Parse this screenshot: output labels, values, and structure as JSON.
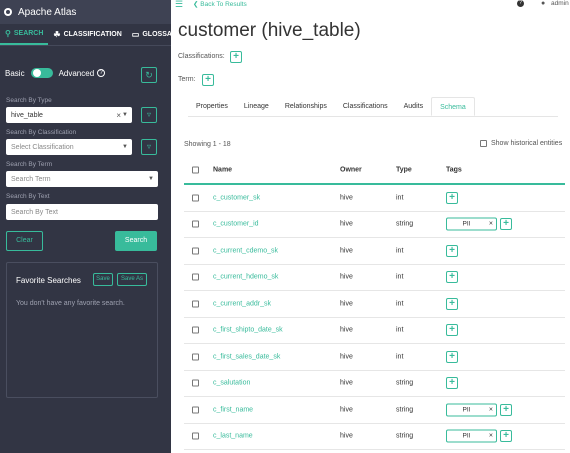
{
  "sidebar": {
    "brand": "Apache Atlas",
    "tabs": [
      {
        "label": "SEARCH",
        "icon": "search-icon"
      },
      {
        "label": "CLASSIFICATION",
        "icon": "tag-icon"
      },
      {
        "label": "GLOSSARY",
        "icon": "folder-icon"
      }
    ],
    "mode_basic": "Basic",
    "mode_advanced": "Advanced",
    "search_by_type_label": "Search By Type",
    "search_by_type_value": "hive_table",
    "search_by_classification_label": "Search By Classification",
    "search_by_classification_placeholder": "Select Classification",
    "search_by_term_label": "Search By Term",
    "search_by_term_placeholder": "Search Term",
    "search_by_text_label": "Search By Text",
    "search_by_text_placeholder": "Search By Text",
    "clear_label": "Clear",
    "search_label": "Search",
    "favorites_title": "Favorite Searches",
    "favorites_save": "Save",
    "favorites_save_as": "Save As",
    "favorites_empty": "You don't have any favorite search."
  },
  "topbar": {
    "back_label": "Back To Results",
    "user_name": "admin"
  },
  "entity": {
    "title": "customer (hive_table)",
    "classifications_label": "Classifications:",
    "term_label": "Term:"
  },
  "tabs": [
    "Properties",
    "Lineage",
    "Relationships",
    "Classifications",
    "Audits",
    "Schema"
  ],
  "active_tab": "Schema",
  "schema": {
    "showing": "Showing 1 - 18",
    "historical_label": "Show historical entities",
    "headers": {
      "name": "Name",
      "owner": "Owner",
      "type": "Type",
      "tags": "Tags"
    },
    "rows": [
      {
        "name": "c_customer_sk",
        "owner": "hive",
        "type": "int",
        "tag": ""
      },
      {
        "name": "c_customer_id",
        "owner": "hive",
        "type": "string",
        "tag": "PII"
      },
      {
        "name": "c_current_cdemo_sk",
        "owner": "hive",
        "type": "int",
        "tag": ""
      },
      {
        "name": "c_current_hdemo_sk",
        "owner": "hive",
        "type": "int",
        "tag": ""
      },
      {
        "name": "c_current_addr_sk",
        "owner": "hive",
        "type": "int",
        "tag": ""
      },
      {
        "name": "c_first_shipto_date_sk",
        "owner": "hive",
        "type": "int",
        "tag": ""
      },
      {
        "name": "c_first_sales_date_sk",
        "owner": "hive",
        "type": "int",
        "tag": ""
      },
      {
        "name": "c_salutation",
        "owner": "hive",
        "type": "string",
        "tag": ""
      },
      {
        "name": "c_first_name",
        "owner": "hive",
        "type": "string",
        "tag": "PII"
      },
      {
        "name": "c_last_name",
        "owner": "hive",
        "type": "string",
        "tag": "PII"
      }
    ]
  },
  "colors": {
    "accent": "#38bb9b",
    "sidebar": "#323544"
  }
}
